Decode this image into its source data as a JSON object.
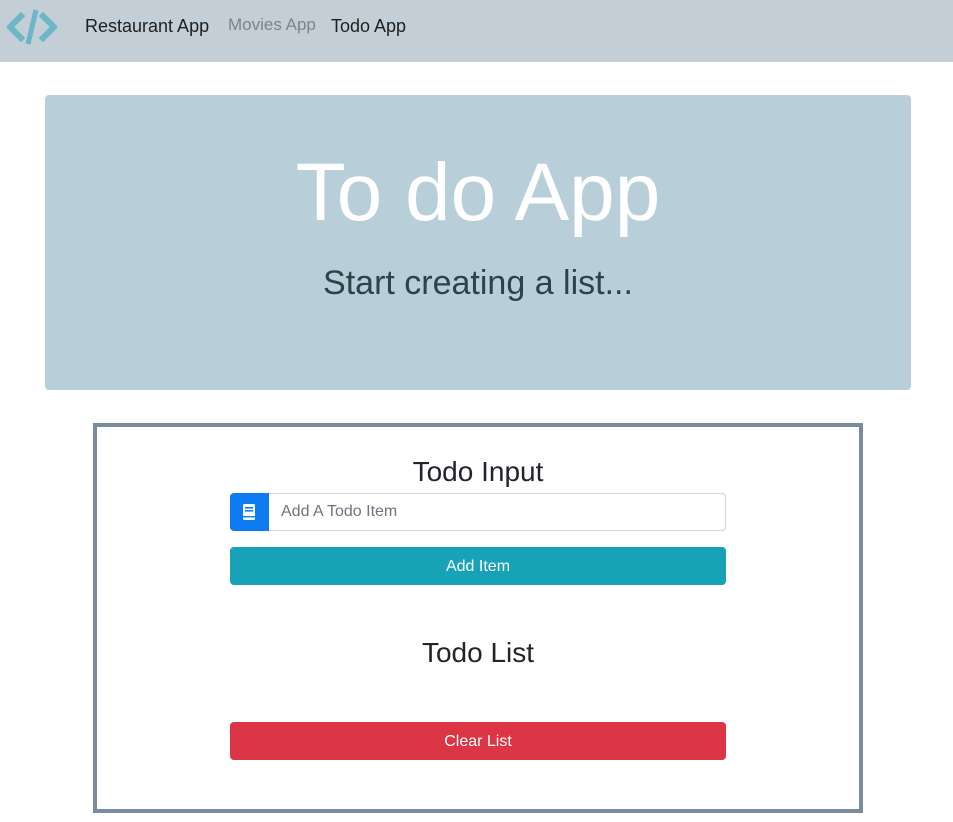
{
  "navbar": {
    "logo_icon": "code-brackets-icon",
    "logo_color": "#6cb6c7",
    "links": [
      {
        "label": "Restaurant App",
        "state": "normal"
      },
      {
        "label": "Movies App",
        "state": "muted"
      },
      {
        "label": "Todo App",
        "state": "normal"
      }
    ]
  },
  "hero": {
    "title": "To do App",
    "subtitle": "Start creating a list..."
  },
  "todo": {
    "input_title": "Todo Input",
    "input_icon": "book-icon",
    "input_value": "",
    "input_placeholder": "Add A Todo Item",
    "add_label": "Add Item",
    "list_title": "Todo List",
    "items": [],
    "clear_label": "Clear List"
  },
  "colors": {
    "navbar_bg": "#c3ced6",
    "hero_bg": "#b8ced9",
    "primary": "#0d7cf2",
    "info": "#17a2b8",
    "danger": "#dc3545",
    "box_border": "#7a8c9c"
  }
}
